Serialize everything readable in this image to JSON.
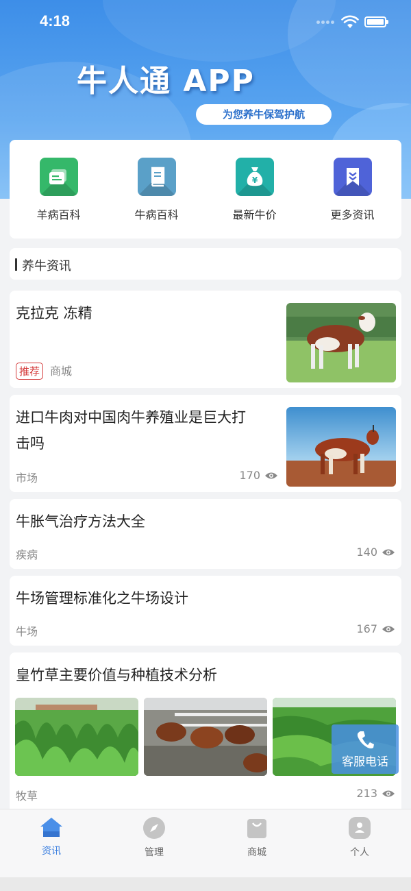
{
  "status_bar": {
    "time": "4:18"
  },
  "header": {
    "app_title": "牛人通 APP",
    "slogan": "为您养牛保驾护航"
  },
  "quick_links": [
    {
      "label": "羊病百科",
      "icon": "book-stack-icon",
      "color": "#35b86a"
    },
    {
      "label": "牛病百科",
      "icon": "notebook-icon",
      "color": "#5aa0c8"
    },
    {
      "label": "最新牛价",
      "icon": "money-bag-icon",
      "color": "#22b0a8"
    },
    {
      "label": "更多资讯",
      "icon": "bookmark-icon",
      "color": "#4f63d8"
    }
  ],
  "section": {
    "title": "养牛资讯"
  },
  "news": [
    {
      "title": "克拉克 冻精",
      "badge": "推荐",
      "tag": "商城",
      "views": ""
    },
    {
      "title_line1": "进口牛肉对中国肉牛养殖业是巨大打",
      "title_line2": "击吗",
      "tag": "市场",
      "views": "170"
    },
    {
      "title": "牛胀气治疗方法大全",
      "tag": "疾病",
      "views": "140"
    },
    {
      "title": "牛场管理标准化之牛场设计",
      "tag": "牛场",
      "views": "167"
    },
    {
      "title": "皇竹草主要价值与种植技术分析",
      "tag": "牧草",
      "views": "213"
    }
  ],
  "customer_service": {
    "label": "客服电话",
    "icon": "phone-icon"
  },
  "tabbar": [
    {
      "label": "资讯",
      "icon": "home-icon",
      "active": true
    },
    {
      "label": "管理",
      "icon": "compass-icon",
      "active": false
    },
    {
      "label": "商城",
      "icon": "shopping-bag-icon",
      "active": false
    },
    {
      "label": "个人",
      "icon": "person-icon",
      "active": false
    }
  ],
  "colors": {
    "accent": "#3b7fe0",
    "badge_red": "#d43a3a",
    "header_blue": "#3d8ee8"
  }
}
